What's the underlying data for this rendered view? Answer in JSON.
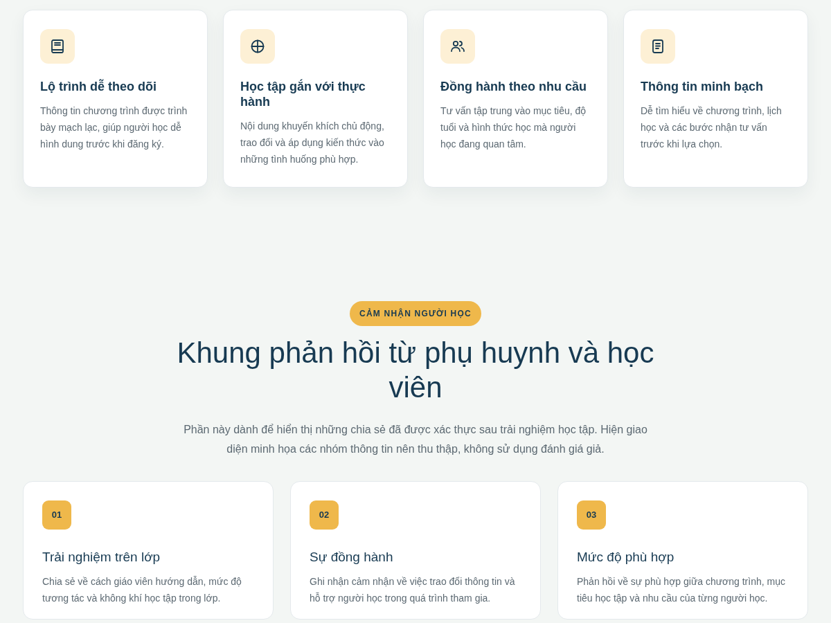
{
  "features": [
    {
      "title": "Lộ trình dễ theo dõi",
      "text": "Thông tin chương trình được trình bày mạch lạc, giúp người học dễ hình dung trước khi đăng ký."
    },
    {
      "title": "Học tập gắn với thực hành",
      "text": "Nội dung khuyến khích chủ động, trao đổi và áp dụng kiến thức vào những tình huống phù hợp."
    },
    {
      "title": "Đồng hành theo nhu cầu",
      "text": "Tư vấn tập trung vào mục tiêu, độ tuổi và hình thức học mà người học đang quan tâm."
    },
    {
      "title": "Thông tin minh bạch",
      "text": "Dễ tìm hiểu về chương trình, lịch học và các bước nhận tư vấn trước khi lựa chọn."
    }
  ],
  "feedback": {
    "badge": "CẢM NHẬN NGƯỜI HỌC",
    "title": "Khung phản hồi từ phụ huynh và học viên",
    "intro": "Phần này dành để hiển thị những chia sẻ đã được xác thực sau trải nghiệm học tập. Hiện giao diện minh họa các nhóm thông tin nên thu thập, không sử dụng đánh giá giả.",
    "cards": [
      {
        "number": "01",
        "title": "Trải nghiệm trên lớp",
        "text": "Chia sẻ về cách giáo viên hướng dẫn, mức độ tương tác và không khí học tập trong lớp."
      },
      {
        "number": "02",
        "title": "Sự đồng hành",
        "text": "Ghi nhận cảm nhận về việc trao đổi thông tin và hỗ trợ người học trong quá trình tham gia."
      },
      {
        "number": "03",
        "title": "Mức độ phù hợp",
        "text": "Phản hồi về sự phù hợp giữa chương trình, mục tiêu học tập và nhu cầu của từng người học."
      }
    ]
  }
}
